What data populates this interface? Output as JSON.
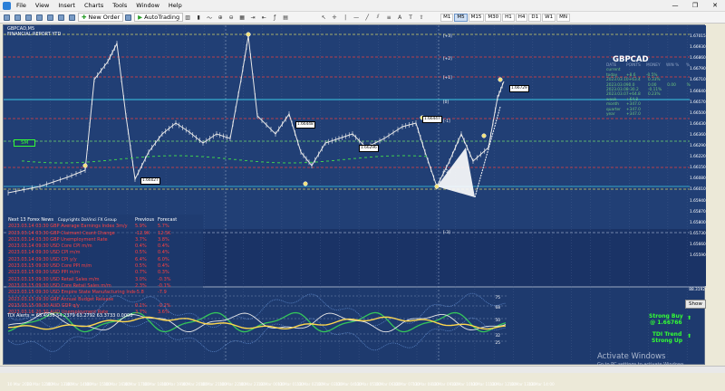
{
  "app": {
    "menu": [
      "File",
      "View",
      "Insert",
      "Charts",
      "Tools",
      "Window",
      "Help"
    ],
    "window_controls": [
      "—",
      "❐",
      "✕"
    ]
  },
  "toolbar": {
    "new_order": "New Order",
    "autotrading": "AutoTrading",
    "timeframes": [
      "M1",
      "M5",
      "M15",
      "M30",
      "H1",
      "H4",
      "D1",
      "W1",
      "MN"
    ],
    "active_timeframe": "M5"
  },
  "chart": {
    "title_line1": "GBPCAD,M5",
    "title_line2": "FINANCIAL REPORT YTD",
    "symbol": "GBPCAD",
    "show_button": "Show",
    "sm_label": "SM",
    "levels": [
      "[+3]",
      "[+2]",
      "[+1]",
      "[0]",
      "[-1]",
      "[-2]",
      "[-3]"
    ],
    "price_boxes": [
      "1.66729",
      "1.66448",
      "1.66447",
      "1.66296",
      "1.66027"
    ],
    "price_axis": [
      "1.67015",
      "1.66930",
      "1.66860",
      "1.66790",
      "1.66710",
      "1.66640",
      "1.66570",
      "1.66500",
      "1.66430",
      "1.66360",
      "1.66290",
      "1.66220",
      "1.66150",
      "1.66080",
      "1.66010",
      "1.65940",
      "1.65870",
      "1.65800",
      "1.65730",
      "1.65660",
      "1.65590"
    ],
    "news_title": "Next 13 Forex News",
    "news_copyright": "Copyrights DaVinci FX Group",
    "news_prev": "Previous",
    "news_fore": "Forecast",
    "news": [
      {
        "name": "2023.03.14 03:30 GBP Average Earnings Index 3m/y",
        "prev": "5.9%",
        "fore": "5.7%"
      },
      {
        "name": "2023.03.14 03:30 GBP Claimant Count Change",
        "prev": "-12.9K",
        "fore": "12.5K"
      },
      {
        "name": "2023.03.14 03:30 GBP Unemployment Rate",
        "prev": "3.7%",
        "fore": "3.8%"
      },
      {
        "name": "2023.03.14 09:30 USD Core CPI m/m",
        "prev": "0.4%",
        "fore": "0.4%"
      },
      {
        "name": "2023.03.14 09:30 USD CPI m/m",
        "prev": "0.5%",
        "fore": "0.4%"
      },
      {
        "name": "2023.03.14 09:30 USD CPI y/y",
        "prev": "6.4%",
        "fore": "6.0%"
      },
      {
        "name": "2023.03.15 09:30 USD Core PPI m/m",
        "prev": "0.5%",
        "fore": "0.4%"
      },
      {
        "name": "2023.03.15 09:30 USD PPI m/m",
        "prev": "0.7%",
        "fore": "0.3%"
      },
      {
        "name": "2023.03.15 09:30 USD Retail Sales m/m",
        "prev": "3.0%",
        "fore": "-0.3%"
      },
      {
        "name": "2023.03.15 09:30 USD Core Retail Sales m/m",
        "prev": "2.3%",
        "fore": "-0.1%"
      },
      {
        "name": "2023.03.15 09:30 USD Empire State Manufacturing Index",
        "prev": "-5.8",
        "fore": "-7.9"
      },
      {
        "name": "2023.03.15 09:30 GBP Annual Budget Release",
        "prev": "",
        "": "",
        "fore": ""
      },
      {
        "name": "2023.03.15 09:30 AUD GDP q/y",
        "prev": "0.1%",
        "fore": "-0.2%"
      },
      {
        "name": "2023.03.16 20:30 AUD Unemployment Rate",
        "prev": "3.7%",
        "fore": "3.6%"
      }
    ],
    "stats": {
      "headers": [
        "DATE",
        "POINTS",
        "MONEY",
        "WIN %",
        "%"
      ],
      "rows": [
        [
          "current",
          "",
          "",
          "",
          ""
        ],
        [
          "today",
          "+8.6",
          "-0.5%",
          "",
          ""
        ],
        [
          "2023.03.10",
          "+63.4",
          "0.33%",
          "",
          ""
        ],
        [
          "2023.03.09",
          "0.0",
          "0.00",
          "0.00",
          "%"
        ],
        [
          "2023.03.08",
          "-30.2",
          "-0.11%",
          "",
          ""
        ],
        [
          "2023.03.07",
          "+64.8",
          "0.23%",
          "",
          ""
        ],
        [
          "week",
          "+64.8",
          "",
          "",
          ""
        ],
        [
          "month",
          "+347.0",
          "",
          "",
          ""
        ],
        [
          "quarter",
          "+347.0",
          "",
          "",
          ""
        ],
        [
          "year",
          "+347.0",
          "",
          "",
          ""
        ]
      ]
    }
  },
  "indicator": {
    "label": "TDI Alerts = 65.4936 54.2379 63.2792 63.3733 0.0000",
    "axis": [
      "88.3192",
      "75",
      "68",
      "50",
      "32",
      "25"
    ],
    "signal1": [
      "Strong Buy",
      "@ 1.66766"
    ],
    "signal2": [
      "TDI Trend",
      "Strong Up"
    ]
  },
  "time_axis": [
    "10 Mar 2023",
    "10 Mar 12:00",
    "10 Mar 13:00",
    "10 Mar 14:00",
    "10 Mar 15:00",
    "10 Mar 16:00",
    "10 Mar 17:00",
    "10 Mar 18:00",
    "10 Mar 19:00",
    "10 Mar 20:00",
    "10 Mar 21:00",
    "10 Mar 22:00",
    "10 Mar 23:00",
    "13 Mar 00:00",
    "13 Mar 01:00",
    "13 Mar 02:00",
    "13 Mar 03:00",
    "13 Mar 04:00",
    "13 Mar 05:00",
    "13 Mar 06:00",
    "13 Mar 07:00",
    "13 Mar 08:00",
    "13 Mar 09:00",
    "13 Mar 10:00",
    "13 Mar 11:00",
    "13 Mar 12:00",
    "13 Mar 13:00",
    "13 Mar 14:00"
  ],
  "watermark": {
    "title": "Activate Windows",
    "sub": "Go to PC settings to activate Windows."
  }
}
